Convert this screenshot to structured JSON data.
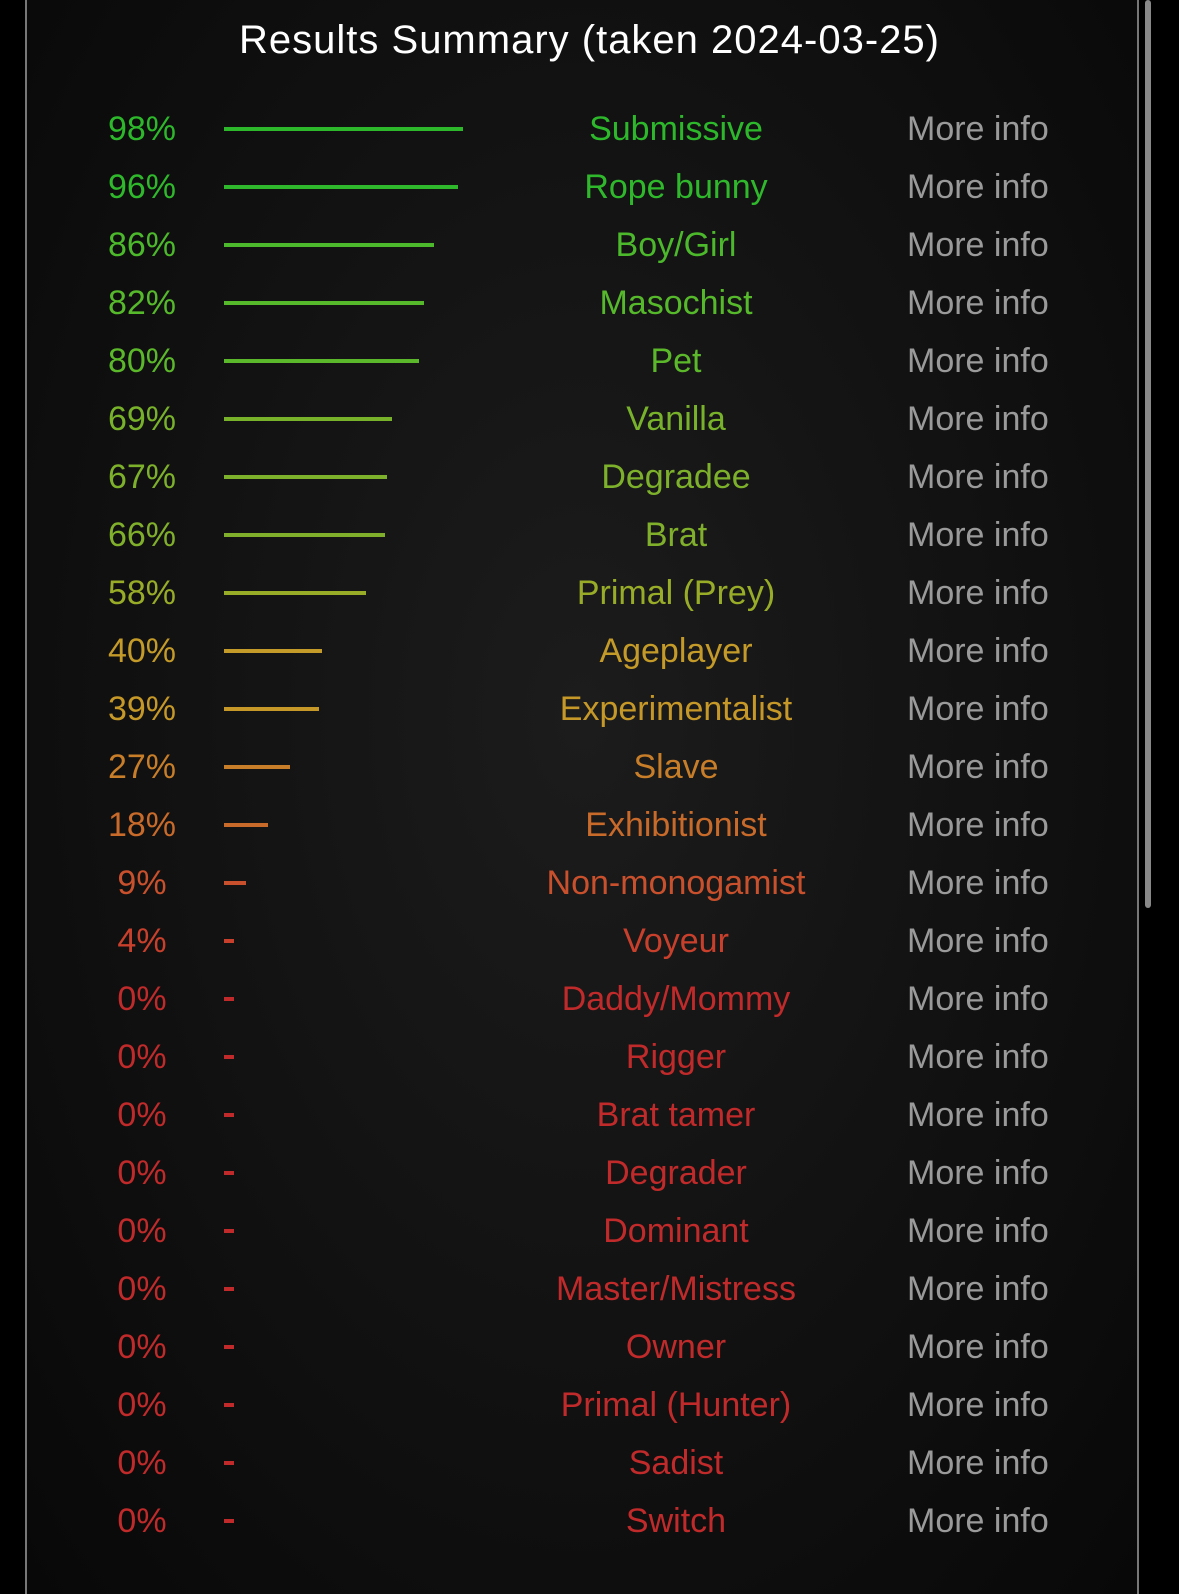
{
  "title": "Results Summary (taken 2024-03-25)",
  "more_info_label": "More info",
  "results": [
    {
      "pct": 98,
      "label": "Submissive",
      "color": "#2db82b"
    },
    {
      "pct": 96,
      "label": "Rope bunny",
      "color": "#2fb82b"
    },
    {
      "pct": 86,
      "label": "Boy/Girl",
      "color": "#4cb82b"
    },
    {
      "pct": 82,
      "label": "Masochist",
      "color": "#56b82b"
    },
    {
      "pct": 80,
      "label": "Pet",
      "color": "#5cb82b"
    },
    {
      "pct": 69,
      "label": "Vanilla",
      "color": "#78b22b"
    },
    {
      "pct": 67,
      "label": "Degradee",
      "color": "#7db02b"
    },
    {
      "pct": 66,
      "label": "Brat",
      "color": "#80b02b"
    },
    {
      "pct": 58,
      "label": "Primal (Prey)",
      "color": "#98ac28"
    },
    {
      "pct": 40,
      "label": "Ageplayer",
      "color": "#c49a28"
    },
    {
      "pct": 39,
      "label": "Experimentalist",
      "color": "#c69828"
    },
    {
      "pct": 27,
      "label": "Slave",
      "color": "#c87e28"
    },
    {
      "pct": 18,
      "label": "Exhibitionist",
      "color": "#c86a2a"
    },
    {
      "pct": 9,
      "label": "Non-monogamist",
      "color": "#c8502c"
    },
    {
      "pct": 4,
      "label": "Voyeur",
      "color": "#c8402c"
    },
    {
      "pct": 0,
      "label": "Daddy/Mommy",
      "color": "#c02a2a"
    },
    {
      "pct": 0,
      "label": "Rigger",
      "color": "#c02a2a"
    },
    {
      "pct": 0,
      "label": "Brat tamer",
      "color": "#c02a2a"
    },
    {
      "pct": 0,
      "label": "Degrader",
      "color": "#c02a2a"
    },
    {
      "pct": 0,
      "label": "Dominant",
      "color": "#c02a2a"
    },
    {
      "pct": 0,
      "label": "Master/Mistress",
      "color": "#c02a2a"
    },
    {
      "pct": 0,
      "label": "Owner",
      "color": "#c02a2a"
    },
    {
      "pct": 0,
      "label": "Primal (Hunter)",
      "color": "#c02a2a"
    },
    {
      "pct": 0,
      "label": "Sadist",
      "color": "#c02a2a"
    },
    {
      "pct": 0,
      "label": "Switch",
      "color": "#c02a2a"
    }
  ]
}
